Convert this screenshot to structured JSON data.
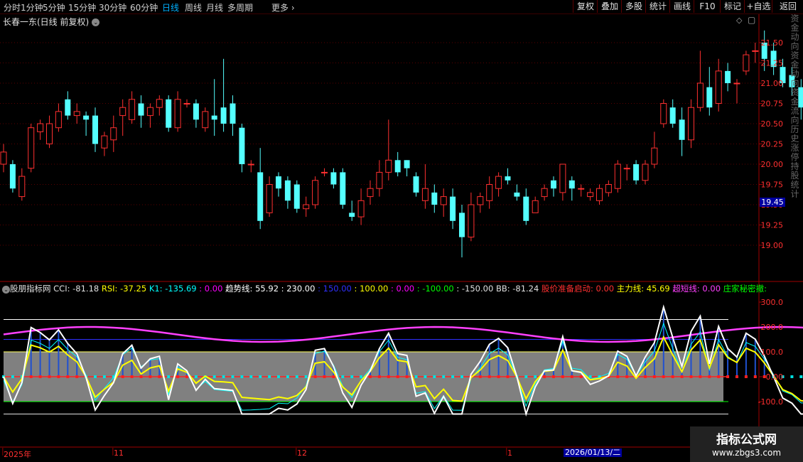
{
  "toolbar": {
    "periods": [
      "分时",
      "1分钟",
      "5分钟",
      "15分钟",
      "30分钟",
      "60分钟",
      "日线",
      "周线",
      "月线",
      "多周期",
      "更多"
    ],
    "active_period": "日线",
    "right_buttons": [
      "复权",
      "叠加",
      "多股",
      "统计",
      "画线",
      "F10",
      "标记",
      "+自选",
      "返回"
    ]
  },
  "chart": {
    "title": "长春一东(日线 前复权)",
    "price_axis": [
      "21.50",
      "21.25",
      "21.00",
      "20.75",
      "20.50",
      "20.25",
      "20.00",
      "19.75",
      "19.50",
      "19.25",
      "19.00"
    ],
    "current_price_tag": "19.45"
  },
  "indicator": {
    "name": "股朋指标网",
    "header": [
      {
        "text": "CCI: -81.18",
        "color": "#e0e0e0"
      },
      {
        "text": "RSI: -37.25",
        "color": "#ffff00"
      },
      {
        "text": "K1: -135.69",
        "color": "#00ffff"
      },
      {
        "text": ": 0.00",
        "color": "#ff00ff"
      },
      {
        "text": "趋势线: 55.92",
        "color": "#ffffff"
      },
      {
        "text": ": 230.00",
        "color": "#ffffff"
      },
      {
        "text": ": 150.00",
        "color": "#3030ff"
      },
      {
        "text": ": 100.00",
        "color": "#ffff00"
      },
      {
        "text": ": 0.00",
        "color": "#ff00ff"
      },
      {
        "text": ": -100.00",
        "color": "#00ff00"
      },
      {
        "text": ": -150.00",
        "color": "#e0e0e0"
      },
      {
        "text": "BB: -81.24",
        "color": "#e0e0e0"
      },
      {
        "text": "股价准备启动: 0.00",
        "color": "#ff3030"
      },
      {
        "text": "主力线: 45.69",
        "color": "#ffff00"
      },
      {
        "text": "超短线: 0.00",
        "color": "#ff40ff"
      },
      {
        "text": "庄家秘密撤:",
        "color": "#00ff00"
      }
    ],
    "axis": [
      "300.0",
      "200.0",
      "100.0",
      "0.00",
      "-100.0"
    ]
  },
  "x_axis": [
    "2025年",
    "11",
    "12",
    "1"
  ],
  "date_badge": "2026/01/13/二",
  "watermark": {
    "line1": "指标公式网",
    "line2": "www.zbgs3.com"
  },
  "side_text": "资金动向资金动向资金流向历史涨停持股统计",
  "chart_data": {
    "type": "candlestick",
    "title": "长春一东(日线 前复权)",
    "ylim": [
      18.75,
      21.75
    ],
    "candles": [
      [
        20.0,
        20.15,
        20.25,
        19.9
      ],
      [
        20.0,
        19.7,
        20.05,
        19.65
      ],
      [
        19.6,
        19.85,
        19.95,
        19.55
      ],
      [
        19.95,
        20.45,
        20.5,
        19.9
      ],
      [
        20.4,
        20.5,
        20.55,
        20.3
      ],
      [
        20.25,
        20.5,
        20.6,
        20.2
      ],
      [
        20.45,
        20.65,
        20.75,
        20.4
      ],
      [
        20.8,
        20.6,
        20.9,
        20.55
      ],
      [
        20.6,
        20.65,
        20.75,
        20.5
      ],
      [
        20.6,
        20.55,
        20.65,
        20.35
      ],
      [
        20.6,
        20.25,
        20.7,
        20.15
      ],
      [
        20.2,
        20.35,
        20.4,
        20.1
      ],
      [
        20.3,
        20.45,
        20.6,
        20.15
      ],
      [
        20.6,
        20.7,
        20.8,
        20.35
      ],
      [
        20.55,
        20.8,
        20.9,
        20.5
      ],
      [
        20.75,
        20.6,
        20.85,
        20.45
      ],
      [
        20.6,
        20.7,
        20.75,
        20.45
      ],
      [
        20.7,
        20.8,
        20.85,
        20.6
      ],
      [
        20.8,
        20.45,
        20.85,
        20.4
      ],
      [
        20.45,
        20.8,
        20.9,
        20.4
      ],
      [
        20.75,
        20.75,
        20.8,
        20.7
      ],
      [
        20.75,
        20.55,
        20.8,
        20.45
      ],
      [
        20.45,
        20.65,
        20.7,
        20.4
      ],
      [
        20.6,
        20.55,
        21.05,
        20.35
      ],
      [
        20.7,
        20.5,
        21.3,
        20.4
      ],
      [
        20.75,
        20.5,
        20.85,
        20.35
      ],
      [
        20.45,
        20.0,
        20.5,
        19.9
      ],
      [
        20.0,
        20.0,
        20.05,
        19.9
      ],
      [
        19.9,
        19.3,
        20.2,
        19.2
      ],
      [
        19.4,
        19.75,
        19.85,
        19.35
      ],
      [
        19.85,
        19.7,
        19.9,
        19.6
      ],
      [
        19.8,
        19.55,
        19.85,
        19.45
      ],
      [
        19.75,
        19.45,
        19.8,
        19.4
      ],
      [
        19.45,
        19.5,
        19.6,
        19.35
      ],
      [
        19.5,
        19.8,
        19.85,
        19.45
      ],
      [
        19.9,
        19.9,
        19.95,
        19.85
      ],
      [
        19.9,
        19.75,
        19.95,
        19.7
      ],
      [
        19.9,
        19.5,
        19.95,
        19.45
      ],
      [
        19.4,
        19.35,
        19.55,
        19.3
      ],
      [
        19.35,
        19.55,
        19.7,
        19.25
      ],
      [
        19.6,
        19.7,
        19.8,
        19.5
      ],
      [
        19.7,
        19.9,
        20.05,
        19.6
      ],
      [
        19.9,
        20.05,
        20.55,
        19.8
      ],
      [
        20.05,
        19.9,
        20.15,
        19.85
      ],
      [
        20.05,
        19.95,
        20.05,
        19.85
      ],
      [
        19.85,
        19.65,
        19.9,
        19.6
      ],
      [
        19.55,
        19.7,
        20.0,
        19.45
      ],
      [
        19.65,
        19.5,
        19.75,
        19.4
      ],
      [
        19.5,
        19.6,
        19.7,
        19.35
      ],
      [
        19.6,
        19.3,
        19.7,
        19.2
      ],
      [
        19.4,
        19.1,
        19.5,
        18.85
      ],
      [
        19.1,
        19.5,
        19.65,
        19.05
      ],
      [
        19.5,
        19.6,
        19.65,
        19.4
      ],
      [
        19.55,
        19.75,
        19.85,
        19.45
      ],
      [
        19.7,
        19.85,
        19.9,
        19.6
      ],
      [
        19.85,
        19.8,
        19.95,
        19.75
      ],
      [
        19.65,
        19.6,
        19.75,
        19.55
      ],
      [
        19.6,
        19.3,
        19.7,
        19.25
      ],
      [
        19.4,
        19.55,
        19.6,
        19.4
      ],
      [
        19.6,
        19.7,
        19.75,
        19.55
      ],
      [
        19.8,
        19.7,
        19.85,
        19.6
      ],
      [
        19.65,
        20.0,
        20.0,
        19.55
      ],
      [
        19.8,
        19.7,
        19.85,
        19.55
      ],
      [
        19.7,
        19.7,
        19.75,
        19.6
      ],
      [
        19.6,
        19.65,
        19.7,
        19.55
      ],
      [
        19.55,
        19.7,
        19.75,
        19.5
      ],
      [
        19.65,
        19.75,
        19.8,
        19.6
      ],
      [
        19.7,
        20.0,
        20.05,
        19.65
      ],
      [
        19.95,
        19.95,
        20.0,
        19.8
      ],
      [
        20.0,
        19.8,
        20.05,
        19.75
      ],
      [
        19.8,
        20.0,
        20.05,
        19.75
      ],
      [
        20.0,
        20.2,
        20.4,
        19.95
      ],
      [
        20.5,
        20.75,
        20.8,
        20.45
      ],
      [
        20.7,
        20.5,
        20.8,
        20.45
      ],
      [
        20.55,
        20.3,
        20.7,
        20.1
      ],
      [
        20.3,
        20.7,
        20.8,
        20.2
      ],
      [
        20.7,
        21.0,
        21.4,
        20.65
      ],
      [
        20.95,
        20.7,
        21.2,
        20.6
      ],
      [
        20.75,
        21.15,
        21.3,
        20.65
      ],
      [
        21.15,
        21.0,
        21.25,
        20.9
      ],
      [
        21.0,
        21.0,
        21.05,
        20.75
      ],
      [
        21.15,
        21.35,
        21.4,
        21.1
      ],
      [
        21.4,
        21.4,
        21.5,
        21.25
      ],
      [
        21.5,
        21.3,
        21.65,
        21.15
      ],
      [
        21.4,
        21.2,
        21.5,
        21.1
      ],
      [
        21.2,
        21.0,
        21.3,
        20.95
      ],
      [
        21.1,
        20.95,
        21.2,
        20.85
      ],
      [
        20.95,
        20.7,
        21.05,
        20.55
      ],
      [
        20.65,
        20.45,
        20.85,
        20.3
      ],
      [
        20.55,
        20.45,
        20.7,
        20.4
      ],
      [
        20.7,
        20.65,
        20.8,
        20.3
      ],
      [
        20.7,
        20.55,
        20.75,
        20.3
      ],
      [
        20.55,
        20.45,
        20.65,
        20.4
      ],
      [
        20.45,
        20.55,
        20.75,
        20.35
      ],
      [
        20.5,
        20.55,
        20.6,
        20.25
      ]
    ],
    "indicator_ylim": [
      -160,
      320
    ]
  }
}
